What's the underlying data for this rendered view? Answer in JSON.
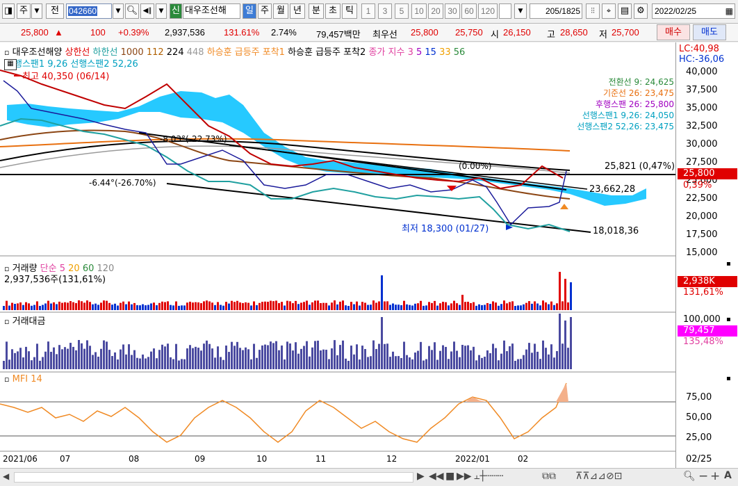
{
  "toolbar": {
    "item_sel": "주",
    "prev_label": "전",
    "code": "042660",
    "stock_name": "대우조선해",
    "new_badge": "신",
    "periods": [
      "일",
      "주",
      "월",
      "년",
      "분",
      "초",
      "틱"
    ],
    "intervals": [
      "1",
      "3",
      "5",
      "10",
      "20",
      "30",
      "60",
      "120"
    ],
    "count": "205",
    "total": "/1825",
    "date": "2022/02/25"
  },
  "quote": {
    "price": "25,800",
    "arrow": "▲",
    "change": "100",
    "change_pct": "+0.39%",
    "volume": "2,937,536",
    "vol_ratio": "131.61%",
    "turnover": "2.74%",
    "amount": "79,457백만",
    "pref_label": "최우선",
    "bid": "25,800",
    "ask": "25,750",
    "open_label": "시",
    "open": "26,150",
    "high_label": "고",
    "high": "28,650",
    "low_label": "저",
    "low": "25,700",
    "buy_label": "매수",
    "sell_label": "매도"
  },
  "main_panel": {
    "legend": {
      "name": "대우조선해양",
      "upper": "상한선",
      "lower": "하한선",
      "ma1": "1000",
      "ma2": "112",
      "ma3": "224",
      "ma4": "448",
      "s1": "하승훈 급등주 포착1",
      "s2": "하승훈 급등주 포착2",
      "s3": "종가 지수",
      "n1": "3",
      "n2": "5",
      "n3": "15",
      "n4": "33",
      "n5": "56",
      "ich": "행스팬1 9,26  선행스팬2 52,26"
    },
    "lc": "LC:40,98",
    "hc": "HC:-36,06",
    "ichimoku": [
      "전환선 9: 24,625",
      "기준선 26: 23,475",
      "후행스팬 26: 25,800",
      "선행스팬1 9,26: 24,050",
      "선행스팬2 52,26: 23,475"
    ],
    "high_note": "최고 40,350 (06/14)",
    "low_note": "최저 18,300 (01/27)",
    "angle1": "-8.03°(-22.73%)",
    "angle2": "-6.44°(-26.70%)",
    "line1": "25,821 (0,47%)",
    "line2": "23,662,28",
    "line3": "18,018,36",
    "mid_note": "(0.00%)",
    "price_tag": "25,800",
    "pct_tag": "0,39%",
    "y_ticks": [
      "40,000",
      "37,500",
      "35,000",
      "32,500",
      "30,000",
      "27,500",
      "25,000",
      "22,500",
      "20,000",
      "17,500",
      "15,000"
    ]
  },
  "vol_panel": {
    "title": "거래량",
    "ma": "단순",
    "m1": "5",
    "m2": "20",
    "m3": "60",
    "m4": "120",
    "value": "2,937,536주(131,61%)",
    "tag": "2,938K",
    "tag2": "131,61%"
  },
  "amt_panel": {
    "title": "거래대금",
    "tick": "100,000",
    "tag": "79,457",
    "tag2": "135,48%"
  },
  "mfi_panel": {
    "title": "MFI 14",
    "ticks": [
      "75,00",
      "50,00",
      "25,00"
    ]
  },
  "x_axis": {
    "labels": [
      "2021/06",
      "07",
      "08",
      "09",
      "10",
      "11",
      "12",
      "2022/01",
      "02"
    ],
    "right": "02/25"
  },
  "colors": {
    "up": "#e00000",
    "down": "#0030d0",
    "cloud": "#00bfff",
    "amount": "#4a4aa0",
    "mfi": "#f08a24"
  }
}
